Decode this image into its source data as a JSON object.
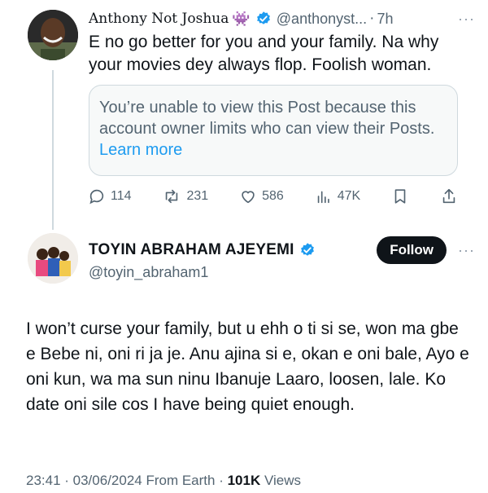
{
  "reply": {
    "author_name": "Anthony Not Joshua",
    "author_emoji": "👾",
    "handle": "@anthonyst...",
    "separator": "·",
    "time": "7h",
    "more": "···",
    "text": "E no go better for you and your family. Na why your movies dey always flop. Foolish woman.",
    "limited_notice": "You’re unable to view this Post because this account owner limits who can view their Posts.",
    "learn_more": "Learn more",
    "stats": {
      "replies": "114",
      "reposts": "231",
      "likes": "586",
      "views": "47K"
    }
  },
  "main_post": {
    "author_name": "TOYIN ABRAHAM AJEYEMI",
    "handle": "@toyin_abraham1",
    "follow_label": "Follow",
    "more": "···",
    "text": "I won’t curse your family, but u ehh o ti si se, won ma gbe e Bebe ni, oni ri ja je. Anu ajina si e, okan e oni bale, Ayo e oni kun, wa ma sun ninu Ibanuje Laaro, loosen, lale. Ko date oni sile cos I have being quiet enough.",
    "timestamp": "23:41 · 03/06/2024 From Earth ·",
    "views_count": "101K",
    "views_label": "Views"
  },
  "colors": {
    "verified_blue": "#1d9bf0",
    "secondary_text": "#536471",
    "follow_button": "#0f1419"
  },
  "icons": [
    "reply-icon",
    "repost-icon",
    "like-icon",
    "views-icon",
    "bookmark-icon",
    "share-icon",
    "verified-badge-icon"
  ]
}
